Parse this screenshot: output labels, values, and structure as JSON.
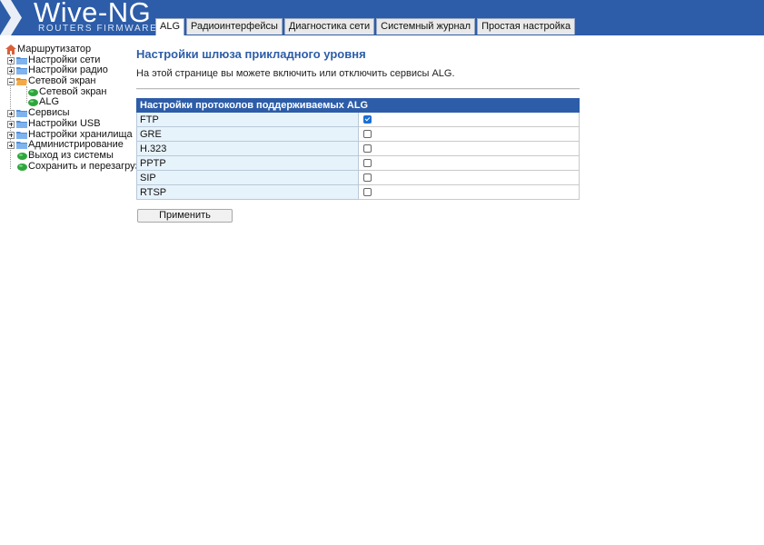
{
  "brand": {
    "title": "Wive-NG",
    "subtitle": "ROUTERS FIRMWARE",
    "color": "#2d5da8"
  },
  "tabs": [
    {
      "label": "ALG",
      "active": true
    },
    {
      "label": "Радиоинтерфейсы",
      "active": false
    },
    {
      "label": "Диагностика сети",
      "active": false
    },
    {
      "label": "Системный журнал",
      "active": false
    },
    {
      "label": "Простая настройка",
      "active": false
    }
  ],
  "tree": {
    "root": {
      "label": "Маршрутизатор",
      "icon": "home-icon"
    },
    "items": [
      {
        "label": "Настройки сети",
        "icon": "folder-icon",
        "expanded": false
      },
      {
        "label": "Настройки радио",
        "icon": "folder-icon",
        "expanded": false
      },
      {
        "label": "Сетевой экран",
        "icon": "folder-open-icon",
        "expanded": true,
        "children": [
          {
            "label": "Сетевой экран",
            "icon": "leaf-icon"
          },
          {
            "label": "ALG",
            "icon": "leaf-icon"
          }
        ]
      },
      {
        "label": "Сервисы",
        "icon": "folder-icon",
        "expanded": false
      },
      {
        "label": "Настройки USB",
        "icon": "folder-icon",
        "expanded": false
      },
      {
        "label": "Настройки хранилища",
        "icon": "folder-icon",
        "expanded": false
      },
      {
        "label": "Администрирование",
        "icon": "folder-icon",
        "expanded": false
      },
      {
        "label": "Выход из системы",
        "icon": "leaf-icon"
      },
      {
        "label": "Сохранить и перезагрузить",
        "icon": "leaf-icon"
      }
    ]
  },
  "page": {
    "title": "Настройки шлюза прикладного уровня",
    "description": "На этой странице вы можете включить или отключить сервисы ALG.",
    "table_header": "Настройки протоколов поддерживаемых ALG",
    "protocols": [
      {
        "name": "FTP",
        "enabled": true
      },
      {
        "name": "GRE",
        "enabled": false
      },
      {
        "name": "H.323",
        "enabled": false
      },
      {
        "name": "PPTP",
        "enabled": false
      },
      {
        "name": "SIP",
        "enabled": false
      },
      {
        "name": "RTSP",
        "enabled": false
      }
    ],
    "apply_label": "Применить"
  }
}
